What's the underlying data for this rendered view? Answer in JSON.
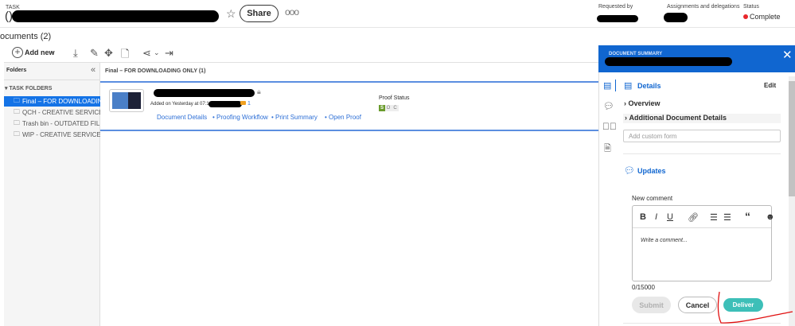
{
  "header": {
    "task_label": "TASK",
    "title_prefix": "()",
    "share_label": "Share",
    "more_icon": "ellipsis-icon",
    "requested_by_label": "Requested by",
    "assignments_label": "Assignments and delegations",
    "status_label": "Status",
    "status_value": "Complete",
    "status_color": "#e8262b"
  },
  "documents_title": "ocuments (2)",
  "toolbar": {
    "add_new_label": "Add new"
  },
  "folders": {
    "title": "Folders",
    "section": "TASK FOLDERS",
    "items": [
      {
        "label": "Final – FOR DOWNLOADING ONLY"
      },
      {
        "label": "QCH - CREATIVE SERVICES TEAM"
      },
      {
        "label": "Trash bin - OUTDATED FILES"
      },
      {
        "label": "WIP - CREATIVE SERVICES TEAM"
      }
    ]
  },
  "main": {
    "folder_title": "Final – FOR DOWNLOADING ONLY (1)",
    "document": {
      "added_text": "Added on Yesterday at 07:12 by",
      "comment_count": "1",
      "links": [
        "Document Details",
        "Proofing Workflow",
        "Print Summary",
        "Open Proof"
      ],
      "proof_status_label": "Proof Status",
      "proof_badges": [
        "S",
        "O",
        "C"
      ]
    }
  },
  "panel": {
    "title": "DOCUMENT SUMMARY",
    "details_label": "Details",
    "edit_label": "Edit",
    "overview_label": "Overview",
    "additional_label": "Additional Document Details",
    "custom_form_placeholder": "Add custom form",
    "updates_label": "Updates",
    "new_comment_label": "New comment",
    "comment_placeholder": "Write a comment...",
    "char_count": "0/15000",
    "submit_label": "Submit",
    "cancel_label": "Cancel",
    "deliver_label": "Deliver",
    "accent": "#1066d0",
    "deliver_color": "#3dbfb8"
  }
}
